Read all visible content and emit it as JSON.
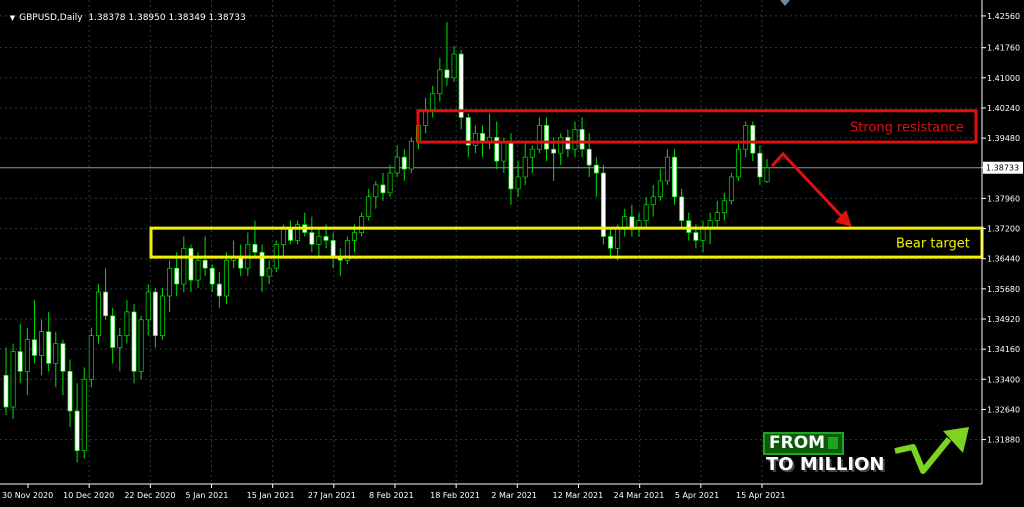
{
  "header": {
    "symbol": "GBPUSD,Daily",
    "ohlc": "1.38378 1.38950 1.38349 1.38733"
  },
  "current_price_label": "1.38733",
  "annotations": {
    "resistance_label": "Strong resistance",
    "target_label": "Bear target",
    "resistance_color": "#e01010",
    "target_color": "#f2f200",
    "arrow_color": "#e01010"
  },
  "logo": {
    "line1": "FROM",
    "line2": "TO MILLION",
    "icon": "rising-arrow-icon"
  },
  "colors": {
    "background": "#000000",
    "bull_candle": "#000000",
    "bull_outline": "#00e000",
    "bear_candle": "#ffffff",
    "wick": "#00e000",
    "grid": "#2a3b46",
    "axis_text": "#ffffff"
  },
  "chart_data": {
    "type": "candlestick",
    "title": "GBPUSD,Daily",
    "ylim": [
      1.3076,
      1.4276
    ],
    "y_ticks": [
      "1.42560",
      "1.41760",
      "1.41000",
      "1.40240",
      "1.39480",
      "1.38733",
      "1.37960",
      "1.37200",
      "1.36440",
      "1.35680",
      "1.34920",
      "1.34160",
      "1.33400",
      "1.32640",
      "1.31880"
    ],
    "x_ticks": [
      "30 Nov 2020",
      "10 Dec 2020",
      "22 Dec 2020",
      "5 Jan 2021",
      "15 Jan 2021",
      "27 Jan 2021",
      "8 Feb 2021",
      "18 Feb 2021",
      "2 Mar 2021",
      "12 Mar 2021",
      "24 Mar 2021",
      "5 Apr 2021",
      "15 Apr 2021"
    ],
    "grid": true,
    "current_price": 1.38733,
    "resistance_zone": [
      1.3938,
      1.4017
    ],
    "target_zone": [
      1.3648,
      1.3721
    ],
    "ohlc": [
      [
        1.335,
        1.342,
        1.325,
        1.327
      ],
      [
        1.327,
        1.343,
        1.324,
        1.341
      ],
      [
        1.341,
        1.348,
        1.333,
        1.336
      ],
      [
        1.336,
        1.347,
        1.33,
        1.344
      ],
      [
        1.344,
        1.354,
        1.338,
        1.34
      ],
      [
        1.34,
        1.349,
        1.335,
        1.346
      ],
      [
        1.346,
        1.351,
        1.336,
        1.338
      ],
      [
        1.338,
        1.346,
        1.332,
        1.343
      ],
      [
        1.343,
        1.344,
        1.33,
        1.336
      ],
      [
        1.336,
        1.339,
        1.322,
        1.326
      ],
      [
        1.326,
        1.333,
        1.313,
        1.316
      ],
      [
        1.316,
        1.337,
        1.314,
        1.334
      ],
      [
        1.334,
        1.347,
        1.332,
        1.345
      ],
      [
        1.345,
        1.358,
        1.343,
        1.356
      ],
      [
        1.356,
        1.362,
        1.349,
        1.35
      ],
      [
        1.35,
        1.352,
        1.338,
        1.342
      ],
      [
        1.342,
        1.347,
        1.336,
        1.345
      ],
      [
        1.345,
        1.354,
        1.343,
        1.351
      ],
      [
        1.351,
        1.353,
        1.333,
        1.336
      ],
      [
        1.336,
        1.35,
        1.334,
        1.349
      ],
      [
        1.349,
        1.358,
        1.345,
        1.356
      ],
      [
        1.356,
        1.357,
        1.342,
        1.345
      ],
      [
        1.345,
        1.357,
        1.344,
        1.355
      ],
      [
        1.355,
        1.364,
        1.351,
        1.362
      ],
      [
        1.362,
        1.366,
        1.355,
        1.358
      ],
      [
        1.358,
        1.37,
        1.356,
        1.367
      ],
      [
        1.367,
        1.368,
        1.356,
        1.359
      ],
      [
        1.359,
        1.366,
        1.357,
        1.364
      ],
      [
        1.364,
        1.37,
        1.36,
        1.362
      ],
      [
        1.362,
        1.363,
        1.356,
        1.358
      ],
      [
        1.358,
        1.361,
        1.352,
        1.355
      ],
      [
        1.355,
        1.366,
        1.353,
        1.364
      ],
      [
        1.364,
        1.369,
        1.362,
        1.365
      ],
      [
        1.365,
        1.368,
        1.36,
        1.362
      ],
      [
        1.362,
        1.371,
        1.36,
        1.368
      ],
      [
        1.368,
        1.374,
        1.365,
        1.366
      ],
      [
        1.366,
        1.368,
        1.356,
        1.36
      ],
      [
        1.36,
        1.364,
        1.358,
        1.362
      ],
      [
        1.362,
        1.369,
        1.361,
        1.368
      ],
      [
        1.368,
        1.373,
        1.365,
        1.372
      ],
      [
        1.372,
        1.374,
        1.368,
        1.369
      ],
      [
        1.369,
        1.374,
        1.368,
        1.373
      ],
      [
        1.373,
        1.376,
        1.37,
        1.371
      ],
      [
        1.371,
        1.375,
        1.366,
        1.368
      ],
      [
        1.368,
        1.372,
        1.365,
        1.37
      ],
      [
        1.37,
        1.373,
        1.367,
        1.369
      ],
      [
        1.369,
        1.371,
        1.362,
        1.365
      ],
      [
        1.365,
        1.367,
        1.36,
        1.364
      ],
      [
        1.364,
        1.37,
        1.363,
        1.369
      ],
      [
        1.369,
        1.373,
        1.366,
        1.371
      ],
      [
        1.371,
        1.376,
        1.37,
        1.375
      ],
      [
        1.375,
        1.382,
        1.374,
        1.38
      ],
      [
        1.38,
        1.384,
        1.377,
        1.383
      ],
      [
        1.383,
        1.386,
        1.379,
        1.381
      ],
      [
        1.381,
        1.388,
        1.38,
        1.386
      ],
      [
        1.386,
        1.393,
        1.385,
        1.39
      ],
      [
        1.39,
        1.392,
        1.384,
        1.387
      ],
      [
        1.387,
        1.395,
        1.386,
        1.394
      ],
      [
        1.394,
        1.4,
        1.392,
        1.398
      ],
      [
        1.398,
        1.405,
        1.396,
        1.402
      ],
      [
        1.402,
        1.408,
        1.4,
        1.406
      ],
      [
        1.406,
        1.415,
        1.404,
        1.412
      ],
      [
        1.412,
        1.424,
        1.408,
        1.41
      ],
      [
        1.41,
        1.418,
        1.409,
        1.416
      ],
      [
        1.416,
        1.417,
        1.397,
        1.4
      ],
      [
        1.4,
        1.401,
        1.39,
        1.393
      ],
      [
        1.393,
        1.398,
        1.391,
        1.396
      ],
      [
        1.396,
        1.398,
        1.39,
        1.394
      ],
      [
        1.394,
        1.401,
        1.392,
        1.395
      ],
      [
        1.395,
        1.399,
        1.387,
        1.389
      ],
      [
        1.389,
        1.395,
        1.386,
        1.394
      ],
      [
        1.394,
        1.396,
        1.378,
        1.382
      ],
      [
        1.382,
        1.389,
        1.38,
        1.385
      ],
      [
        1.385,
        1.394,
        1.383,
        1.39
      ],
      [
        1.39,
        1.393,
        1.386,
        1.392
      ],
      [
        1.392,
        1.4,
        1.391,
        1.398
      ],
      [
        1.398,
        1.4,
        1.389,
        1.392
      ],
      [
        1.392,
        1.395,
        1.384,
        1.391
      ],
      [
        1.391,
        1.396,
        1.388,
        1.395
      ],
      [
        1.395,
        1.397,
        1.39,
        1.392
      ],
      [
        1.392,
        1.399,
        1.39,
        1.397
      ],
      [
        1.397,
        1.4,
        1.39,
        1.392
      ],
      [
        1.392,
        1.396,
        1.385,
        1.388
      ],
      [
        1.388,
        1.39,
        1.38,
        1.386
      ],
      [
        1.386,
        1.388,
        1.368,
        1.37
      ],
      [
        1.37,
        1.372,
        1.365,
        1.367
      ],
      [
        1.367,
        1.373,
        1.364,
        1.372
      ],
      [
        1.372,
        1.377,
        1.37,
        1.375
      ],
      [
        1.375,
        1.378,
        1.37,
        1.372
      ],
      [
        1.372,
        1.376,
        1.37,
        1.374
      ],
      [
        1.374,
        1.38,
        1.372,
        1.378
      ],
      [
        1.378,
        1.383,
        1.375,
        1.38
      ],
      [
        1.38,
        1.387,
        1.379,
        1.384
      ],
      [
        1.384,
        1.392,
        1.383,
        1.39
      ],
      [
        1.39,
        1.392,
        1.378,
        1.38
      ],
      [
        1.38,
        1.382,
        1.372,
        1.374
      ],
      [
        1.374,
        1.376,
        1.369,
        1.371
      ],
      [
        1.371,
        1.373,
        1.367,
        1.369
      ],
      [
        1.369,
        1.374,
        1.366,
        1.372
      ],
      [
        1.372,
        1.376,
        1.368,
        1.374
      ],
      [
        1.374,
        1.379,
        1.372,
        1.376
      ],
      [
        1.376,
        1.381,
        1.374,
        1.379
      ],
      [
        1.379,
        1.386,
        1.378,
        1.385
      ],
      [
        1.385,
        1.394,
        1.384,
        1.392
      ],
      [
        1.392,
        1.399,
        1.39,
        1.398
      ],
      [
        1.398,
        1.399,
        1.389,
        1.391
      ],
      [
        1.391,
        1.393,
        1.383,
        1.385
      ],
      [
        1.3838,
        1.3895,
        1.3835,
        1.3873
      ]
    ]
  }
}
